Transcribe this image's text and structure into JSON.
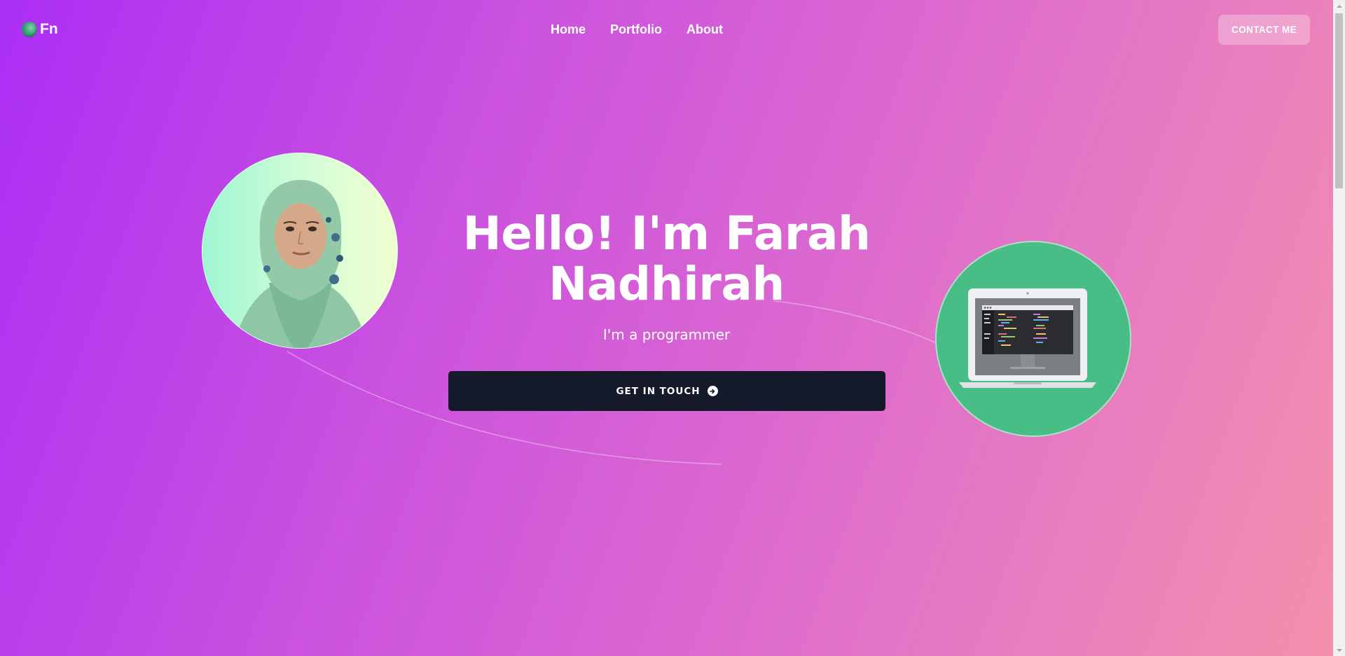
{
  "navbar": {
    "logo_text": "Fn",
    "links": [
      {
        "label": "Home"
      },
      {
        "label": "Portfolio"
      },
      {
        "label": "About"
      }
    ],
    "contact_label": "CONTACT ME"
  },
  "hero": {
    "title_line1": "Hello! I'm Farah",
    "title_line2": "Nadhirah",
    "subtitle": "I'm a programmer",
    "cta_label": "GET IN TOUCH",
    "cta_icon": "arrow-circle-right-icon"
  },
  "images": {
    "profile": "profile-photo",
    "laptop": "laptop-code-illustration"
  },
  "colors": {
    "gradient_start": "#ab2ef5",
    "gradient_end": "#f490ab",
    "cta_background": "#141a29",
    "laptop_circle": "#48bd86"
  }
}
